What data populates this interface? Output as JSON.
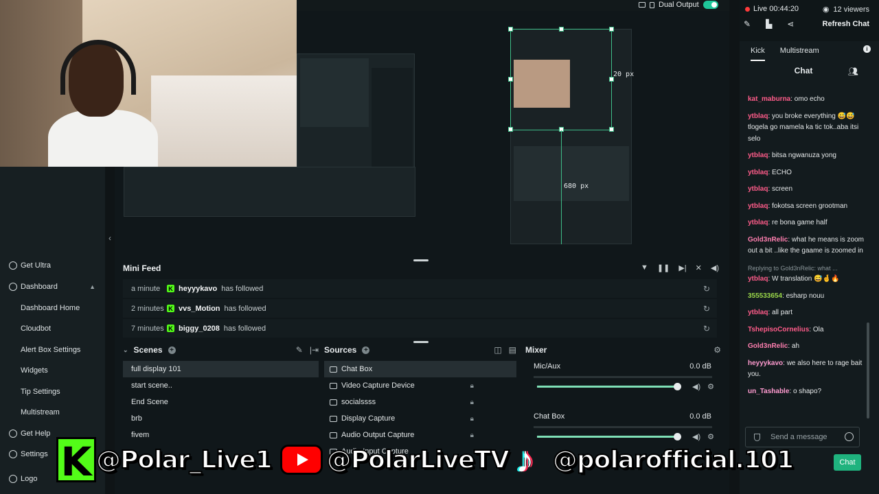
{
  "top_bar": {
    "dual_output_label": "Dual Output"
  },
  "sidebar": {
    "items": [
      {
        "label": "Get Ultra"
      },
      {
        "label": "Dashboard"
      },
      {
        "label": "Dashboard Home"
      },
      {
        "label": "Cloudbot"
      },
      {
        "label": "Alert Box Settings"
      },
      {
        "label": "Widgets"
      },
      {
        "label": "Tip Settings"
      },
      {
        "label": "Multistream"
      },
      {
        "label": "Get Help"
      },
      {
        "label": "Settings"
      },
      {
        "label": "Logo"
      }
    ]
  },
  "canvas": {
    "width_label": "680 px",
    "offset_label": "20 px"
  },
  "mini_feed": {
    "title": "Mini Feed",
    "rows": [
      {
        "time": "a minute",
        "user": "heyyykavo",
        "action": "has followed"
      },
      {
        "time": "2 minutes",
        "user": "vvs_Motion",
        "action": "has followed"
      },
      {
        "time": "7 minutes",
        "user": "biggy_0208",
        "action": "has followed"
      }
    ]
  },
  "scenes": {
    "title": "Scenes",
    "items": [
      "full display 101",
      "start scene..",
      "End Scene",
      "brb",
      "fivem"
    ]
  },
  "sources": {
    "title": "Sources",
    "items": [
      "Chat Box",
      "Video Capture Device",
      "socialssss",
      "Display Capture",
      "Audio Output Capture",
      "Audio Input Capture"
    ]
  },
  "mixer": {
    "title": "Mixer",
    "channels": [
      {
        "name": "Mic/Aux",
        "db": "0.0 dB",
        "level": 0.95
      },
      {
        "name": "Chat Box",
        "db": "0.0 dB",
        "level": 0.95
      }
    ]
  },
  "chat_panel": {
    "live_label": "Live 00:44:20",
    "viewers": "12 viewers",
    "refresh_label": "Refresh Chat",
    "tabs": [
      "Kick",
      "Multistream"
    ],
    "title": "Chat",
    "messages": [
      {
        "user": "kat_maburna",
        "color": "#ff5c8a",
        "text": ": omo echo"
      },
      {
        "user": "ytblaq",
        "color": "#ff5c8a",
        "text": ": you broke everything 😅😅tlogela go mamela ka tic tok..aba itsi selo"
      },
      {
        "user": "ytblaq",
        "color": "#ff5c8a",
        "text": ": bitsa ngwanuza yong"
      },
      {
        "user": "ytblaq",
        "color": "#ff5c8a",
        "text": ": ECHO"
      },
      {
        "user": "ytblaq",
        "color": "#ff5c8a",
        "text": ": screen"
      },
      {
        "user": "ytblaq",
        "color": "#ff5c8a",
        "text": ": fokotsa screen grootman"
      },
      {
        "user": "ytblaq",
        "color": "#ff5c8a",
        "text": ": re bona game half"
      },
      {
        "user": "Gold3nRelic",
        "color": "#ff7fb0",
        "text": ": what he means is zoom out a bit ..like the gaame is zoomed in"
      },
      {
        "reply": "Replying to Gold3nRelic: what ...",
        "user": "ytblaq",
        "color": "#ff5c8a",
        "text": ": W translation 😅🤞🔥"
      },
      {
        "user": "355533654",
        "color": "#9bd84a",
        "text": ": esharp nouu"
      },
      {
        "user": "ytblaq",
        "color": "#ff5c8a",
        "text": ": all part"
      },
      {
        "user": "TshepisoCornelius",
        "color": "#ff5c8a",
        "text": ": Ola"
      },
      {
        "user": "Gold3nRelic",
        "color": "#ff7fb0",
        "text": ": ah"
      },
      {
        "user": "heyyykavo",
        "color": "#ff9bd0",
        "text": ": we also here to rage bait you."
      },
      {
        "user": "un_Tashable",
        "color": "#ff9bd0",
        "text": ": o shapo?"
      }
    ],
    "input_placeholder": "Send a message",
    "send_label": "Chat"
  },
  "overlay": {
    "kick_handle": "@Polar_Live1",
    "youtube_handle": "@PolarLiveTV",
    "tiktok_handle": "@polarofficial.101"
  },
  "colors": {
    "accent": "#1fb37e",
    "kick": "#53fc18",
    "youtube": "#ff0000"
  }
}
